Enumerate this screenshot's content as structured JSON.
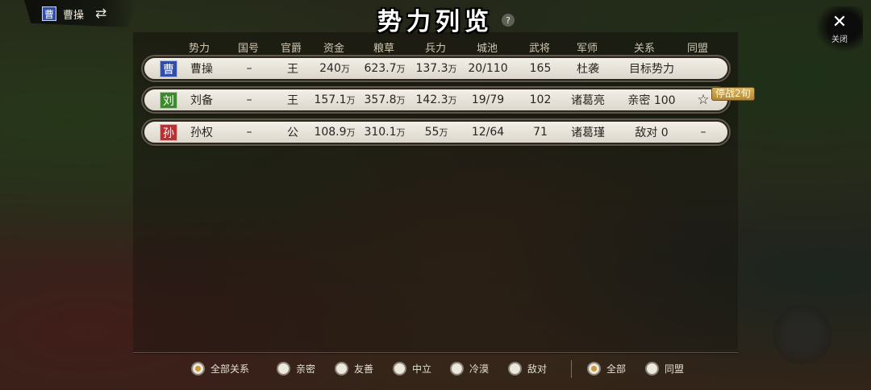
{
  "player": {
    "tag": "曹",
    "tag_color": "#2f4fa8",
    "name": "曹操",
    "swap_icon": "swap-arrows-icon"
  },
  "title": "势力列览",
  "help": "?",
  "close": {
    "label": "关闭",
    "icon": "close-icon"
  },
  "columns": [
    "势力",
    "国号",
    "官爵",
    "资金",
    "粮草",
    "兵力",
    "城池",
    "武将",
    "军师",
    "关系",
    "同盟"
  ],
  "rows": [
    {
      "tag": "曹",
      "tag_color": "#2f4fa8",
      "name": "曹操",
      "state": "–",
      "rank": "王",
      "funds": "240",
      "food": "623.7",
      "troops": "137.3",
      "unit": "万",
      "cities": "20/110",
      "generals": "165",
      "strategist": "杜袭",
      "relation": "目标势力",
      "alliance": ""
    },
    {
      "tag": "刘",
      "tag_color": "#3c8a2a",
      "name": "刘备",
      "state": "–",
      "rank": "王",
      "funds": "157.1",
      "food": "357.8",
      "troops": "142.3",
      "unit": "万",
      "cities": "19/79",
      "generals": "102",
      "strategist": "诸葛亮",
      "relation": "亲密 100",
      "alliance": "star-icon",
      "badge": "停战2旬"
    },
    {
      "tag": "孙",
      "tag_color": "#b83232",
      "name": "孙权",
      "state": "–",
      "rank": "公",
      "funds": "108.9",
      "food": "310.1",
      "troops": "55",
      "unit": "万",
      "cities": "12/64",
      "generals": "71",
      "strategist": "诸葛瑾",
      "relation": "敌对 0",
      "alliance": "–"
    }
  ],
  "filters": {
    "relation": [
      "全部关系",
      "亲密",
      "友善",
      "中立",
      "冷漠",
      "敌对"
    ],
    "relation_selected": "全部关系",
    "alliance": [
      "全部",
      "同盟"
    ],
    "alliance_selected": "全部"
  },
  "colors": {
    "accent": "#c89a3a",
    "row_bg": "#ece8de",
    "badge": "#c9a046"
  }
}
